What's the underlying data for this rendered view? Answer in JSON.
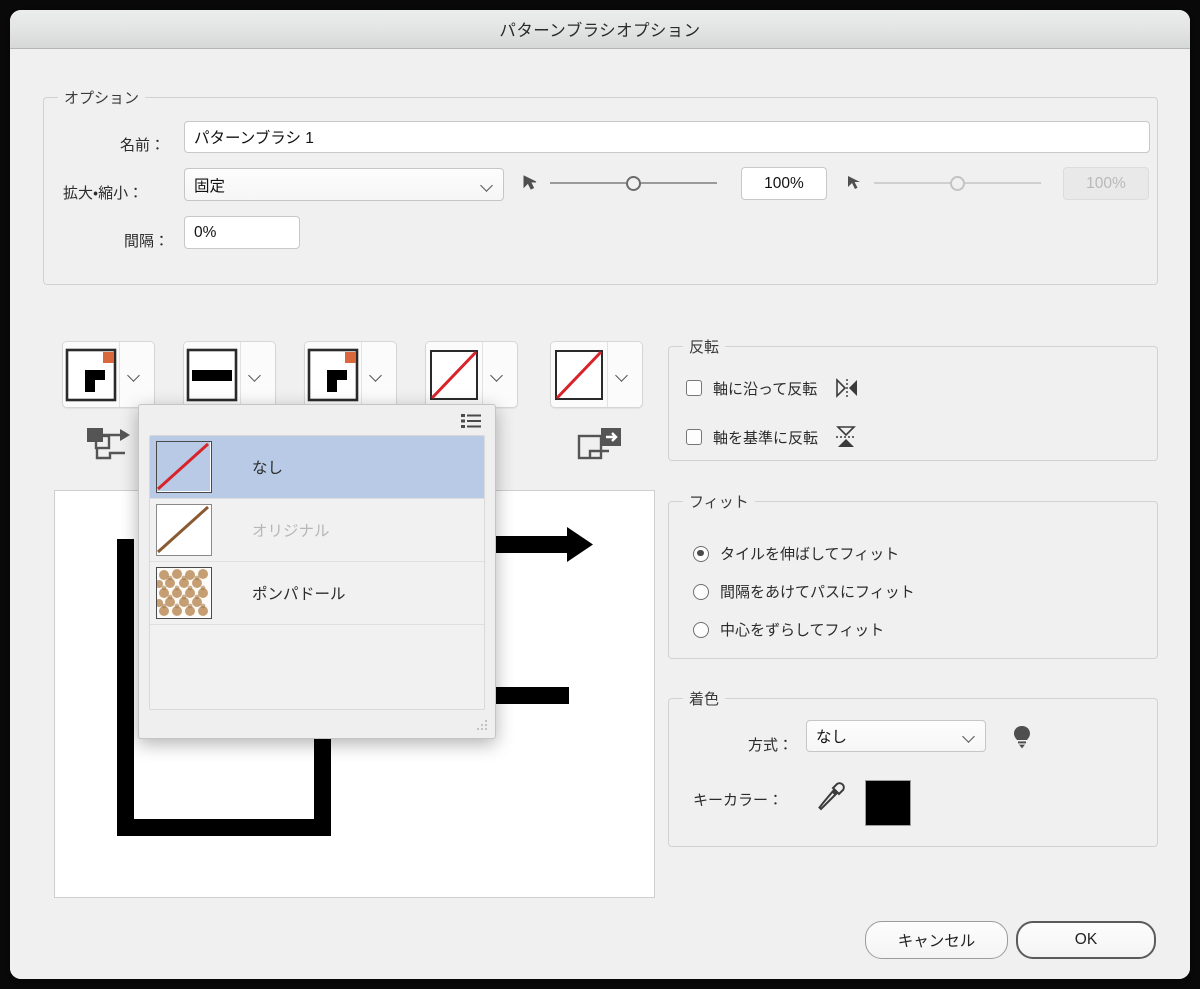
{
  "window": {
    "title": "パターンブラシオプション"
  },
  "options_group": {
    "legend": "オプション",
    "name_label": "名前：",
    "name_value": "パターンブラシ 1",
    "scale_label": "拡大・縮小：",
    "scale_mode": "固定",
    "scale_value_1": "100%",
    "scale_value_2": "100%",
    "spacing_label": "間隔：",
    "spacing_value": "0%"
  },
  "tiles": {
    "items": [
      {
        "name": "outer-corner-tile",
        "kind": "corner",
        "has_badge": true
      },
      {
        "name": "side-tile",
        "kind": "side",
        "has_badge": false
      },
      {
        "name": "inner-corner-tile",
        "kind": "corner",
        "has_badge": true
      },
      {
        "name": "start-tile",
        "kind": "none",
        "has_badge": false
      },
      {
        "name": "end-tile",
        "kind": "none",
        "has_badge": false
      }
    ],
    "left_corner_icon": "outer-corner-indicator-icon",
    "right_corner_icon": "inner-corner-indicator-icon"
  },
  "popup": {
    "list_view_icon": "list-view-icon",
    "resize_grip_icon": "resize-grip-icon",
    "items": [
      {
        "label": "なし",
        "swatch": "none-slash",
        "selected": true,
        "disabled": false
      },
      {
        "label": "オリジナル",
        "swatch": "original-slash",
        "selected": false,
        "disabled": true
      },
      {
        "label": "ポンパドール",
        "swatch": "pompadour-pattern",
        "selected": false,
        "disabled": false
      }
    ]
  },
  "flip_group": {
    "legend": "反転",
    "items": [
      {
        "label": "軸に沿って反転",
        "checked": false,
        "icon": "flip-along-axis-icon"
      },
      {
        "label": "軸を基準に反転",
        "checked": false,
        "icon": "flip-across-axis-icon"
      }
    ]
  },
  "fit_group": {
    "legend": "フィット",
    "items": [
      {
        "label": "タイルを伸ばしてフィット",
        "selected": true
      },
      {
        "label": "間隔をあけてパスにフィット",
        "selected": false
      },
      {
        "label": "中心をずらしてフィット",
        "selected": false
      }
    ]
  },
  "colorization_group": {
    "legend": "着色",
    "method_label": "方式：",
    "method_value": "なし",
    "tip_icon": "lightbulb-icon",
    "key_color_label": "キーカラー：",
    "eyedropper_icon": "eyedropper-icon",
    "key_color_swatch": "#000000"
  },
  "footer": {
    "cancel_label": "キャンセル",
    "ok_label": "OK"
  },
  "colors": {
    "dialog_bg": "#f0f0f0",
    "selection_blue": "#b8cae6",
    "slash_red": "#d8232a",
    "badge_orange": "#d9693c",
    "pattern_brown": "#c49a6c"
  }
}
